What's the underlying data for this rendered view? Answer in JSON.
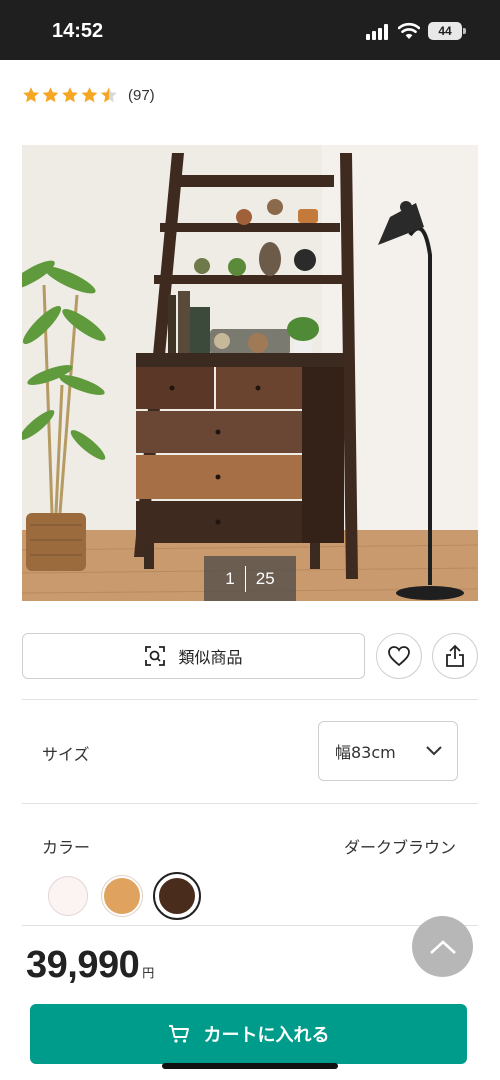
{
  "status_bar": {
    "time": "14:52",
    "battery": "44",
    "icons": [
      "signal-icon",
      "wifi-icon",
      "battery-icon"
    ]
  },
  "rating": {
    "stars": 4.5,
    "count": "(97)",
    "icon": "star-icon"
  },
  "gallery": {
    "current": "1",
    "total": "25"
  },
  "actions": {
    "similar_label": "類似商品",
    "similar_icon": "image-search-icon",
    "favorite_icon": "heart-icon",
    "share_icon": "share-icon"
  },
  "size": {
    "label": "サイズ",
    "value": "幅83cm",
    "icon": "chevron-down-icon"
  },
  "color": {
    "label": "カラー",
    "selected": "ダークブラウン",
    "swatches": [
      {
        "color": "#fbf4f2",
        "selected": false
      },
      {
        "color": "#e0a25f",
        "selected": false
      },
      {
        "color": "#4a2c1c",
        "selected": true
      }
    ]
  },
  "price": {
    "amount": "39,990",
    "unit": "円"
  },
  "cart": {
    "label": "カートに入れる",
    "icon": "cart-icon"
  },
  "colors": {
    "accent": "#009c8b",
    "star": "#f5a623",
    "status_bar": "#1f1f1f"
  }
}
